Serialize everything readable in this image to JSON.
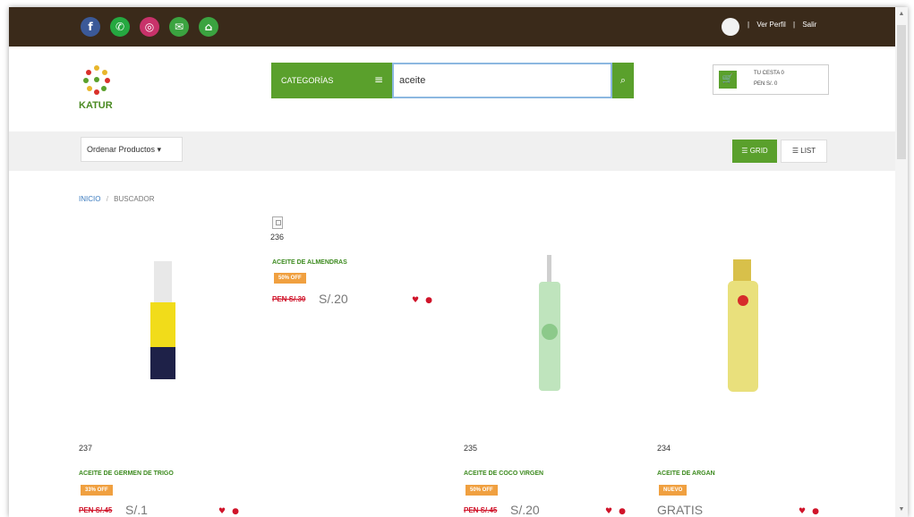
{
  "social": [
    {
      "icon": "facebook-icon",
      "glyph": "f",
      "color": "#3b5998"
    },
    {
      "icon": "whatsapp-icon",
      "glyph": "✆",
      "color": "#25a840"
    },
    {
      "icon": "instagram-icon",
      "glyph": "◎",
      "color": "#c8326a"
    },
    {
      "icon": "mail-icon",
      "glyph": "✉",
      "color": "#3ba340"
    },
    {
      "icon": "home-icon",
      "glyph": "⌂",
      "color": "#3ba340"
    }
  ],
  "user": {
    "sep1": "|",
    "profile": "Ver Perfil",
    "sep2": "|",
    "logout": "Salir"
  },
  "logo": {
    "text": "KATUR"
  },
  "categories_label": "CATEGORÍAS",
  "search": {
    "value": "aceite"
  },
  "cart": {
    "line1": "TU CESTA 0",
    "line2": "PEN S/. 0"
  },
  "order_label": "Ordenar Productos ▾",
  "view": {
    "grid": "GRID",
    "list": "LIST"
  },
  "breadcrumb": {
    "home": "INICIO",
    "sep": "/",
    "current": "BUSCADOR"
  },
  "products": [
    {
      "id": "236",
      "name": "ACEITE DE ALMENDRAS",
      "badge": "50% OFF",
      "old_price": "PEN S/.30",
      "price": "S/.20"
    },
    {
      "id": "237",
      "name": "ACEITE DE GERMEN DE TRIGO",
      "badge": "33% OFF",
      "old_price": "PEN S/.45",
      "price": "S/.1"
    },
    {
      "id": "235",
      "name": "ACEITE DE COCO VIRGEN",
      "badge": "50% OFF",
      "old_price": "PEN S/.45",
      "price": "S/.20"
    },
    {
      "id": "234",
      "name": "ACEITE DE ARGAN",
      "badge": "NUEVO",
      "old_price": "",
      "price": "GRATIS"
    }
  ],
  "actions": {
    "wishlist": "♥",
    "cart": "●"
  },
  "colors": {
    "topbar": "#3a2a1a",
    "accent": "#5aa02c",
    "price_red": "#d0142a",
    "badge": "#f0a040"
  }
}
